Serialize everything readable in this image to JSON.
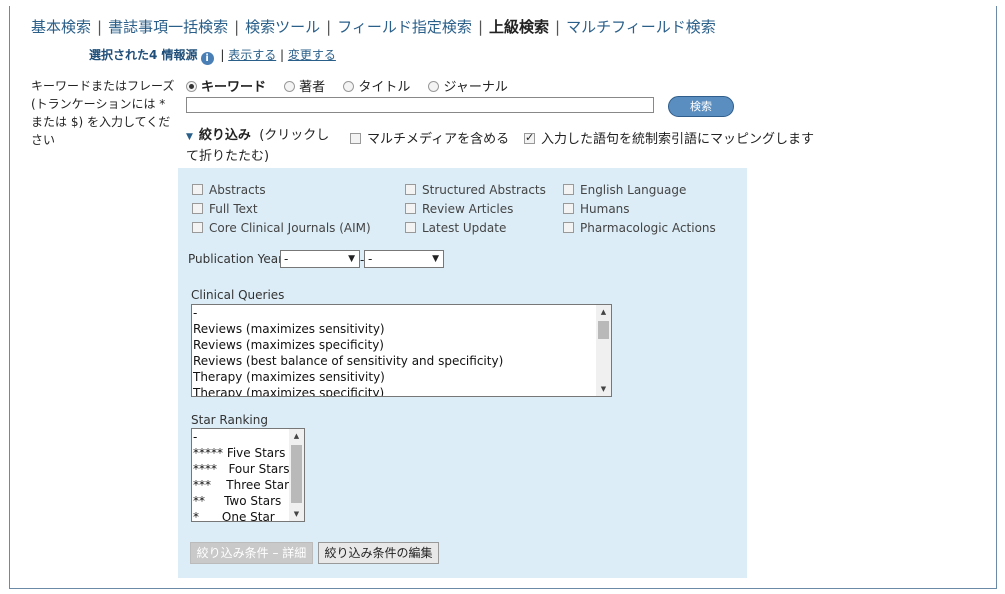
{
  "nav": {
    "items": [
      {
        "label": "基本検索"
      },
      {
        "label": "書誌事項一括検索"
      },
      {
        "label": "検索ツール"
      },
      {
        "label": "フィールド指定検索"
      },
      {
        "label": "上級検索"
      },
      {
        "label": "マルチフィールド検索"
      }
    ],
    "active_index": 4
  },
  "sources": {
    "selected_label": "選択された4 情報源",
    "info_icon": "i",
    "show_link": "表示する",
    "change_link": "変更する"
  },
  "search": {
    "side_label": "キーワードまたはフレーズ (トランケーションには * または $) を入力してください",
    "options": [
      "キーワード",
      "著者",
      "タイトル",
      "ジャーナル"
    ],
    "selected_option": "キーワード",
    "query_value": "",
    "button_label": "検索"
  },
  "limits": {
    "toggle_heading": "絞り込み",
    "toggle_hint": "(クリックして折りたたむ)",
    "multimedia_label": "マルチメディアを含める",
    "multimedia_checked": false,
    "mapping_label": "入力した語句を統制索引語にマッピングします",
    "mapping_checked": true,
    "checkboxes": [
      {
        "label": "Abstracts",
        "checked": false
      },
      {
        "label": "Structured Abstracts",
        "checked": false
      },
      {
        "label": "English Language",
        "checked": false
      },
      {
        "label": "Full Text",
        "checked": false
      },
      {
        "label": "Review Articles",
        "checked": false
      },
      {
        "label": "Humans",
        "checked": false
      },
      {
        "label": "Core Clinical Journals (AIM)",
        "checked": false
      },
      {
        "label": "Latest Update",
        "checked": false
      },
      {
        "label": "Pharmacologic Actions",
        "checked": false
      }
    ],
    "pub_year_label": "Publication Year",
    "pub_year_from": "-",
    "pub_year_to": "-",
    "range_sep": "-",
    "clinical_label": "Clinical Queries",
    "clinical_options": [
      "-",
      "Reviews (maximizes sensitivity)",
      "Reviews (maximizes specificity)",
      "Reviews (best balance of sensitivity and specificity)",
      "Therapy (maximizes sensitivity)",
      "Therapy (maximizes specificity)"
    ],
    "star_label": "Star Ranking",
    "star_options": [
      "-",
      "***** Five Stars",
      "****   Four Stars",
      "***    Three Stars",
      "**     Two Stars",
      "*      One Star"
    ],
    "btn_details": "絞り込み条件 – 詳細",
    "btn_edit": "絞り込み条件の編集"
  }
}
